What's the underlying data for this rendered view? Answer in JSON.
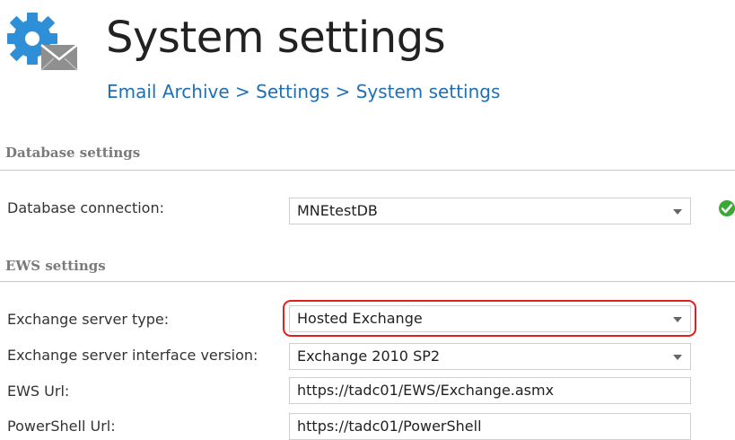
{
  "header": {
    "icon": "gear-envelope-icon",
    "title": "System settings",
    "breadcrumb": {
      "items": [
        "Email Archive",
        "Settings",
        "System settings"
      ],
      "separator": ">"
    }
  },
  "database_settings": {
    "section_title": "Database settings",
    "connection": {
      "label": "Database connection:",
      "value": "MNEtestDB",
      "status_icon": "check-circle-icon",
      "status_color": "#3aa935"
    }
  },
  "ews_settings": {
    "section_title": "EWS settings",
    "server_type": {
      "label": "Exchange server type:",
      "value": "Hosted Exchange",
      "highlighted": true,
      "highlight_color": "#e02020"
    },
    "interface_version": {
      "label": "Exchange server interface version:",
      "value": "Exchange 2010 SP2"
    },
    "ews_url": {
      "label": "EWS Url:",
      "value": "https://tadc01/EWS/Exchange.asmx"
    },
    "powershell_url": {
      "label": "PowerShell Url:",
      "value": "https://tadc01/PowerShell"
    }
  },
  "colors": {
    "title": "#222222",
    "breadcrumb_link": "#1f6fb5",
    "section_header": "#7a7a7a",
    "gear": "#2e8fd6"
  }
}
